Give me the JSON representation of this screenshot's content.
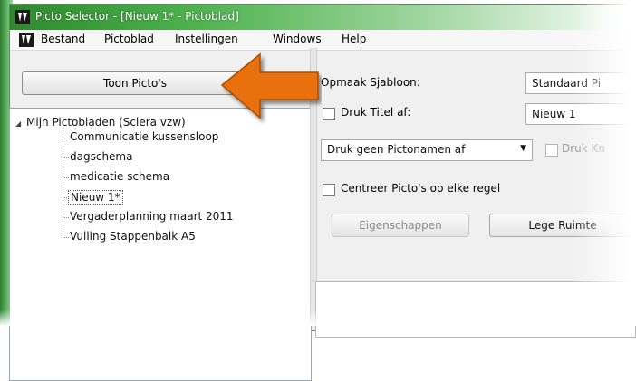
{
  "window": {
    "title": "Picto Selector - [Nieuw 1* - Pictoblad]"
  },
  "menu": {
    "items": [
      "Bestand",
      "Pictoblad",
      "Instellingen",
      "Windows",
      "Help"
    ]
  },
  "left": {
    "toon_button": "Toon Picto's",
    "tree": {
      "root": "Mijn Pictobladen (Sclera vzw)",
      "items": [
        "Communicatie kussensloop",
        "dagschema",
        "medicatie schema",
        "Nieuw 1*",
        "Vergaderplanning maart 2011",
        "Vulling Stappenbalk A5"
      ],
      "selected_index": 3
    }
  },
  "right": {
    "opmaak_label": "Opmaak Sjabloon:",
    "opmaak_value": "Standaard Pi",
    "druk_titel_label": "Druk Titel af:",
    "titel_value": "Nieuw 1",
    "pictonamen_select": "Druk geen Pictonamen af",
    "druk_kn_label": "Druk Kn",
    "centreer_label": "Centreer Picto's op elke regel",
    "eigenschappen_button": "Eigenschappen",
    "lege_ruimte_button": "Lege Ruimte"
  },
  "colors": {
    "titlebar": "#2c8a2c",
    "arrow": "#e8700a"
  }
}
